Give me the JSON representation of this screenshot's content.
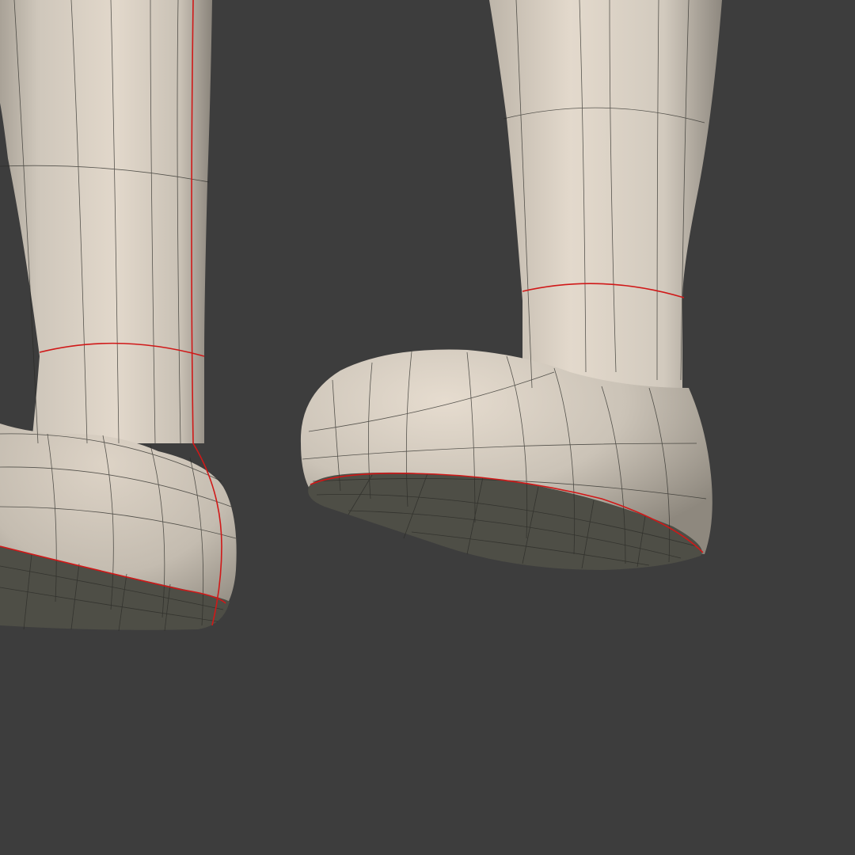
{
  "viewport": {
    "background_color": "#3d3d3d",
    "mesh_fill_color": "#d9d1c5",
    "mesh_shadow_color": "#8f887e",
    "sole_color": "#4e4e46",
    "wire_color": "#2a2a26",
    "seam_color": "#d01818",
    "objects": [
      {
        "name": "left-leg-mesh",
        "shading": "smooth",
        "wireframe": true
      },
      {
        "name": "right-leg-mesh",
        "shading": "smooth",
        "wireframe": true
      }
    ]
  }
}
